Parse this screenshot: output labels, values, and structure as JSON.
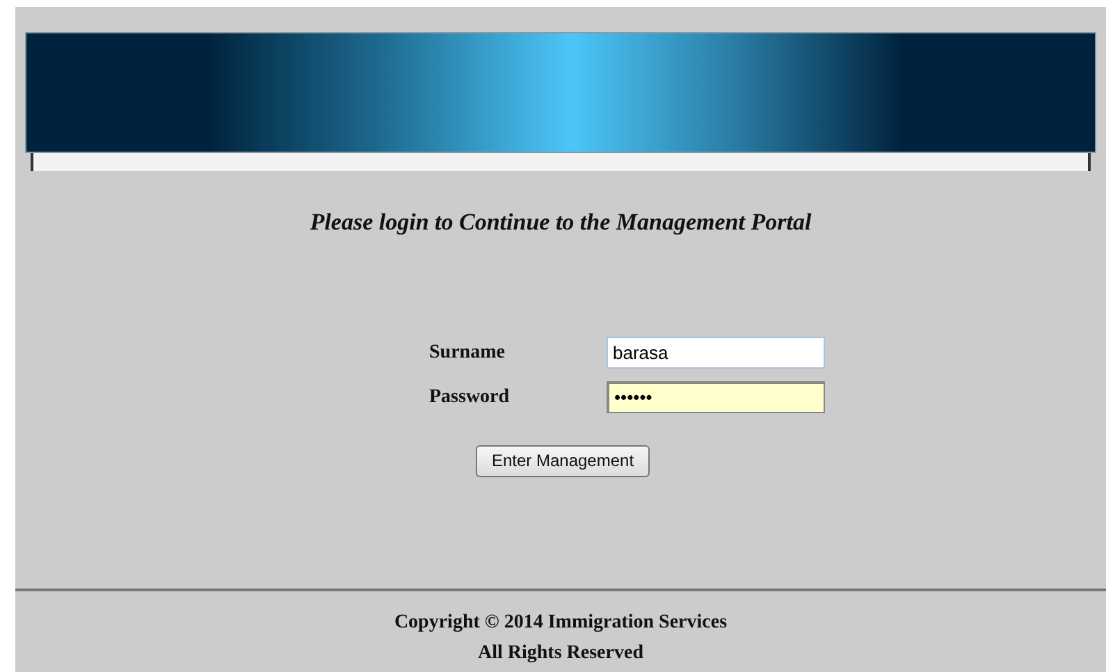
{
  "heading": "Please login to Continue to the Management Portal",
  "fields": [
    {
      "label": "Surname",
      "value": "barasa",
      "autofilled": false
    },
    {
      "label": "Password",
      "value": "••••••",
      "autofilled": true
    }
  ],
  "button": "Enter Management",
  "footer": [
    "Copyright © 2014 Immigration Services",
    "All Rights Reserved"
  ]
}
